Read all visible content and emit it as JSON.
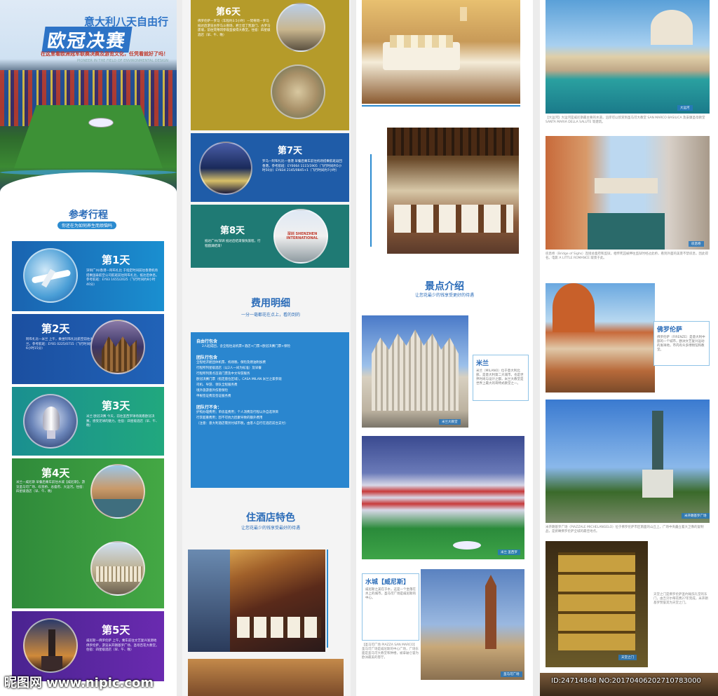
{
  "hero": {
    "title": "意大利八天自由行",
    "big_title": "欧冠决赛",
    "subtitle": "在这里看欧洲冠军联赛决赛及游览文化，任凭看就好了吗！",
    "en_text": "PIONEER IN THE FIELD OF ENVIRONMENTAL DESIGN"
  },
  "itinerary": {
    "title": "参考行程",
    "subtitle": "你还在为如何养生而烦恼吗",
    "days": [
      {
        "label": "第1天",
        "text": "深圳广州/香港—阿布扎比 于指定时间前往香港机场搭乘国泰航空公司航班前往阿布扎比，抵达后休息。参考航班：EY83 1655/2025（飞行时间约8小时40分）"
      },
      {
        "label": "第2天",
        "text": "阿布扎比—米兰 上午，乘坐阿布扎比航空前往米兰。参考航班：EY81 0225/0715（飞行时间约6小时15分）"
      },
      {
        "label": "第3天",
        "text": "米兰 欧冠决赛 今天，前往圣西罗球场观看欧冠决赛，感受足球的魅力。住宿：四星级酒店（早、午、晚）"
      },
      {
        "label": "第4天",
        "text": "米兰—威尼斯 早餐后乘车前往水城【威尼斯】，游览圣马可广场、叹息桥、总督府、大运河。住宿：四星级酒店（早、午、晚）"
      },
      {
        "label": "第5天",
        "text": "威尼斯—佛罗伦萨 上午，乘车前往文艺复兴发源地佛罗伦萨，游览米开朗基罗广场、圣母百花大教堂。住宿：四星级酒店（早、午、晚）"
      }
    ]
  },
  "day6": {
    "label": "第6天",
    "text": "佛罗伦萨—罗马（车程约3.5小时）—梵蒂冈—罗马 抵达后游览古罗马斗兽场、君士坦丁凯旋门、古罗马废墟，前往梵蒂冈参观圣彼得大教堂。住宿：四星级酒店（早、午、晚）"
  },
  "day7": {
    "label": "第7天",
    "text": "罗马—阿布扎比—香港 早餐后乘车前往机场搭乘航班返回香港。参考航班：EY0064 1115/1905（飞行时间约5小时50分）EY834 2145/0845+1（飞行时间约7小时）"
  },
  "day8": {
    "label": "第8天",
    "text": "抵达广州/深圳 抵达后结束愉快旅程，行程圆满结束！",
    "sign": "深圳 SHENZHEN INTERNATIONAL"
  },
  "fees": {
    "title": "费用明细",
    "subtitle": "一分一毫都花在点上，看的到的",
    "sections": [
      {
        "head": "自由行包含",
        "lines": [
          "2人起成团，含全程往返机票+酒店+门票+欧冠决赛门票+保险"
        ]
      },
      {
        "head": "团队行包含",
        "lines": [
          "全程经济舱团体机票、机场税、保险及燃油附加费",
          "行程所列星级酒店（以2人一间为标准）及早餐",
          "行程所列景点首道门票及中文导游服务",
          "欧冠决赛门票（指定座位区域），CASA MILAN 米兰之家参观",
          "司机、导游、领队全程服务费",
          "境外旅游意外伤害保险",
          "申根签证费及签证服务费"
        ]
      },
      {
        "head": "团队行不含：",
        "lines": [
          "护照办理费用；单房差费用；个人消费及行程以外自选项目",
          "行李超重费用；因不可抗力因素导致的额外费用",
          "（注意：意大利酒店需另付城市税，由客人自行在酒店前台支付）"
        ]
      }
    ]
  },
  "hotel": {
    "title": "住酒店特色",
    "subtitle": "让您花最少的钱享受最好的待遇"
  },
  "spots": {
    "title": "景点介绍",
    "subtitle": "让您花最少的钱享受更好的待遇",
    "milan": {
      "name": "米兰",
      "text": "米兰（MILANO）位于意大利北部，是意大利第二大城市，也是世界时尚与设计之都，米兰大教堂是世界上最大的哥特式教堂之一。",
      "tag": "米兰大教堂"
    },
    "stadium_tag": "米兰 圣西罗",
    "venice": {
      "name": "水城【威尼斯】",
      "text": "威尼斯之美在于水，这是一个坐落在水上的城市，圣马可广场是威尼斯的中心。",
      "tag": "圣马可广场",
      "caption": "【圣马可广场 PIAZZA SAN MARCO】圣马可广场是威尼斯的中心广场，广场东面是圣马可大教堂和钟楼，被拿破仑誉为欧洲最美的客厅。"
    }
  },
  "col4": {
    "grand_canal_tag": "大运河",
    "grand_canal_caption": "【大运河】大运河是威尼斯最主要的水道，沿岸可以欣赏到圣马可大教堂 SAN MARCO BASILICA 及安康圣母教堂 SANTA MARIA DELLA SALUTE 等建筑。",
    "sighs_tag": "叹息桥",
    "sighs_caption": "叹息桥（Bridge of Sighs）连接总督府和监狱，相传死囚被押往监狱时经过此桥，看到外面的美景不禁叹息，因此得名。电影 A LITTLE ROMANCE 取景于此。",
    "florence": {
      "name": "佛罗伦萨",
      "text": "佛罗伦萨（FIRENZE）是意大利中部的一个城市，欧洲文艺复兴运动的发祥地，市内有众多博物馆和教堂。"
    },
    "michelangelo_tag": "米开朗基罗广场",
    "michelangelo_caption": "米开朗基罗广场（PIAZZALE MICHELANGELO）位于佛罗伦萨市区南面的山丘上，广场中央矗立着大卫像的复制品，是俯瞰佛罗伦萨全城的最佳地点。",
    "gate_tag": "天堂之门",
    "gate_caption": "天堂之门是佛罗伦萨圣约翰洗礼堂的东门，由吉贝尔蒂花费27年完成，米开朗基罗赞誉其为天堂之门。"
  },
  "watermark": {
    "site": "昵图网 www.nipic.com",
    "id": "ID:24714848 NO:20170406202710783000"
  },
  "colors": {
    "accent": "#2b6cb8",
    "day1": "#1a63b0",
    "day2": "#1b56a8",
    "day3": "#1b9a86",
    "day4": "#3a9a3a",
    "day5": "#5e2aa0",
    "day6": "#b59b2a"
  }
}
